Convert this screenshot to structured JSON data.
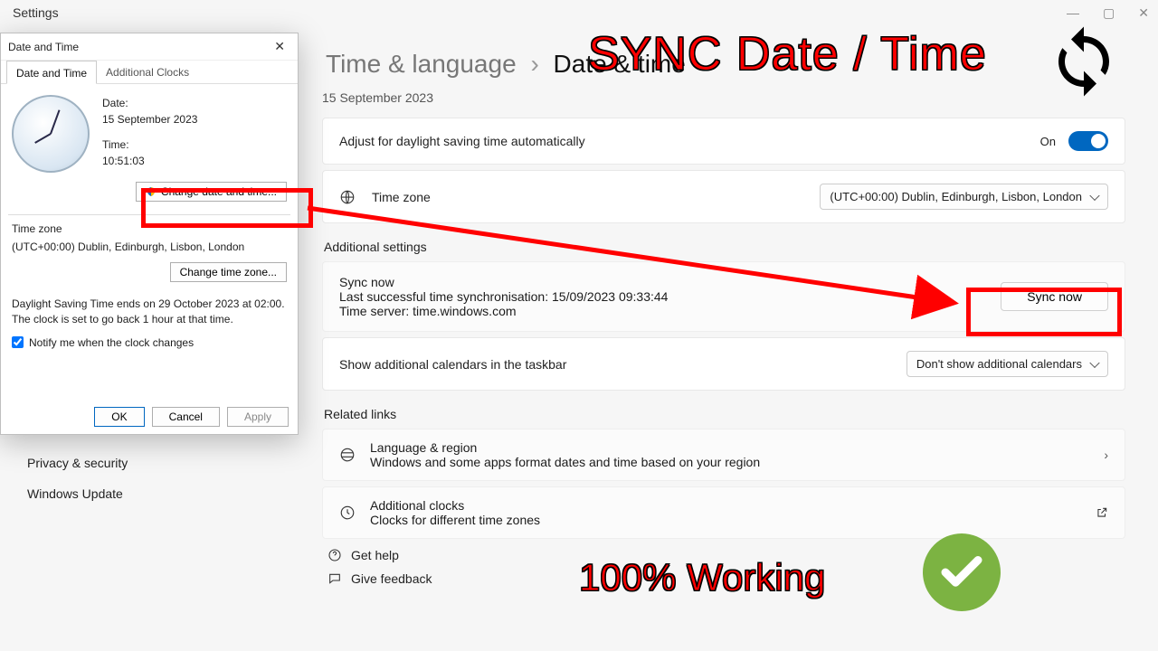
{
  "window": {
    "app_title": "Settings"
  },
  "breadcrumb": {
    "parent": "Time & language",
    "current": "Date & time"
  },
  "page": {
    "date_line": "15 September 2023"
  },
  "dst": {
    "label": "Adjust for daylight saving time automatically",
    "state_text": "On"
  },
  "timezone": {
    "label": "Time zone",
    "value": "(UTC+00:00) Dublin, Edinburgh, Lisbon, London"
  },
  "additional": {
    "heading": "Additional settings",
    "sync_title": "Sync now",
    "sync_last": "Last successful time synchronisation: 15/09/2023 09:33:44",
    "sync_server": "Time server: time.windows.com",
    "sync_button": "Sync now",
    "calendars_label": "Show additional calendars in the taskbar",
    "calendars_value": "Don't show additional calendars"
  },
  "related": {
    "heading": "Related links",
    "lang_title": "Language & region",
    "lang_sub": "Windows and some apps format dates and time based on your region",
    "clocks_title": "Additional clocks",
    "clocks_sub": "Clocks for different time zones",
    "help": "Get help",
    "feedback": "Give feedback"
  },
  "sidebar": {
    "privacy": "Privacy & security",
    "update": "Windows Update"
  },
  "legacy": {
    "title": "Date and Time",
    "tab1": "Date and Time",
    "tab2": "Additional Clocks",
    "date_k": "Date:",
    "date_v": "15 September 2023",
    "time_k": "Time:",
    "time_v": "10:51:03",
    "change_btn": "Change date and time...",
    "tz_heading": "Time zone",
    "tz_value": "(UTC+00:00) Dublin, Edinburgh, Lisbon, London",
    "change_tz_btn": "Change time zone...",
    "dst_note": "Daylight Saving Time ends on 29 October 2023 at 02:00. The clock is set to go back 1 hour at that time.",
    "notify": "Notify me when the clock changes",
    "ok": "OK",
    "cancel": "Cancel",
    "apply": "Apply"
  },
  "overlay": {
    "title": "SYNC Date / Time",
    "working": "100% Working"
  }
}
